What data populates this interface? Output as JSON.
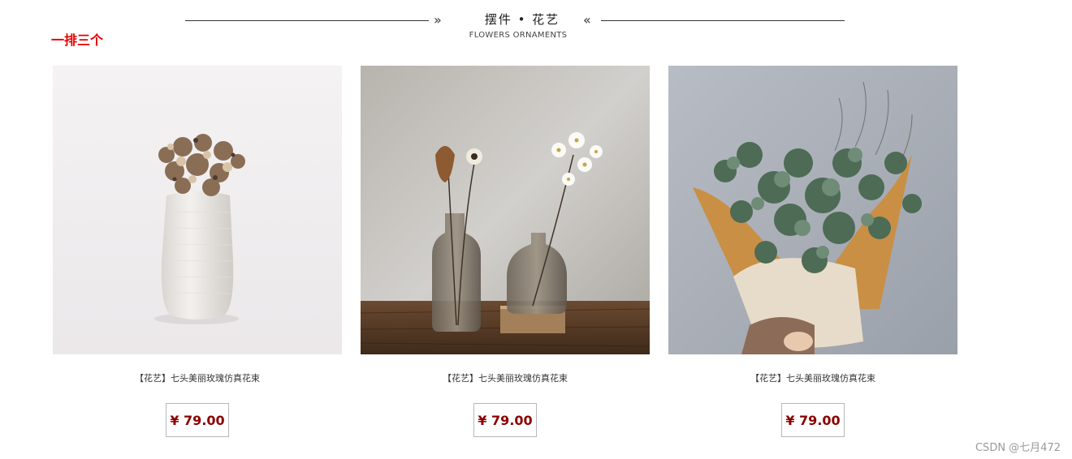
{
  "note": "一排三个",
  "section": {
    "title": "摆件 • 花艺",
    "subtitle": "FLOWERS ORNAMENTS",
    "left_chevron": "»",
    "right_chevron": "«"
  },
  "products": [
    {
      "name": "【花艺】七头美丽玫瑰仿真花束",
      "price": "¥ 79.00"
    },
    {
      "name": "【花艺】七头美丽玫瑰仿真花束",
      "price": "¥ 79.00"
    },
    {
      "name": "【花艺】七头美丽玫瑰仿真花束",
      "price": "¥ 79.00"
    }
  ],
  "watermark": "CSDN @七月472"
}
